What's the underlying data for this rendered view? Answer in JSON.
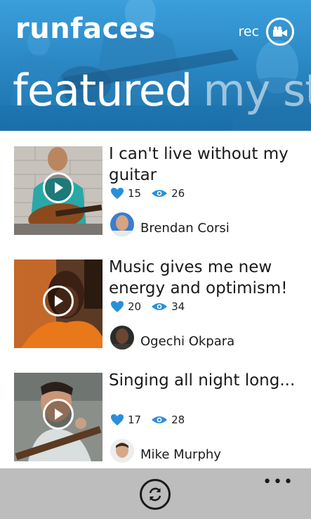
{
  "app": {
    "logo": "runfaces",
    "rec_label": "rec"
  },
  "pivot": {
    "active": "featured",
    "inactive": "my strea"
  },
  "videos": [
    {
      "title": "I can't live without my guitar",
      "likes": "15",
      "views": "26",
      "author": "Brendan Corsi"
    },
    {
      "title": "Music gives me new energy and optimism!",
      "likes": "20",
      "views": "34",
      "author": "Ogechi Okpara"
    },
    {
      "title": "Singing all night long...",
      "likes": "17",
      "views": "28",
      "author": "Mike Murphy"
    }
  ],
  "appbar": {
    "more": "•••"
  },
  "colors": {
    "accent": "#1f8ad0",
    "heart": "#2a8fd8",
    "appbar": "#bdbdbd"
  },
  "icons": [
    "video-camera-icon",
    "play-icon",
    "heart-icon",
    "eye-icon",
    "refresh-icon",
    "more-icon"
  ]
}
